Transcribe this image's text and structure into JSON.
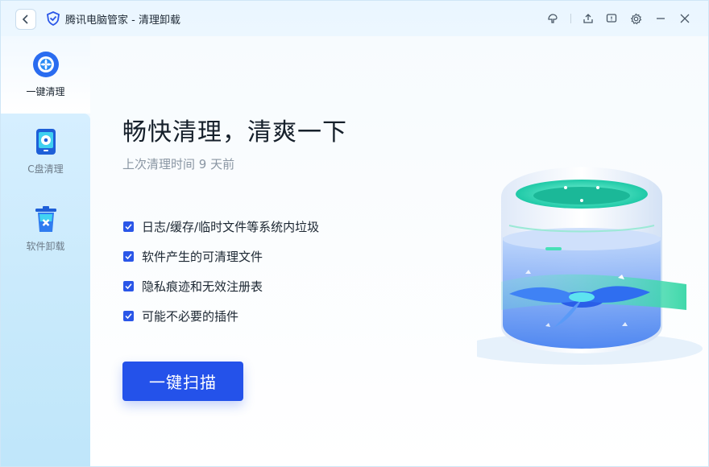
{
  "window": {
    "title": "腾讯电脑管家 - 清理卸载"
  },
  "titlebar_icons": [
    "back-icon",
    "skin-icon",
    "share-icon",
    "feedback-icon",
    "settings-icon",
    "minimize-icon",
    "close-icon"
  ],
  "sidebar": {
    "items": [
      {
        "label": "一键清理",
        "icon": "one-click-clean-icon",
        "active": true
      },
      {
        "label": "C盘清理",
        "icon": "c-drive-icon",
        "active": false
      },
      {
        "label": "软件卸载",
        "icon": "uninstall-trash-icon",
        "active": false
      }
    ]
  },
  "main": {
    "headline": "畅快清理，清爽一下",
    "subline": "上次清理时间 9 天前",
    "checklist": [
      {
        "label": "日志/缓存/临时文件等系统内垃圾",
        "checked": true
      },
      {
        "label": "软件产生的可清理文件",
        "checked": true
      },
      {
        "label": "隐私痕迹和无效注册表",
        "checked": true
      },
      {
        "label": "可能不必要的插件",
        "checked": true
      }
    ],
    "scan_button": "一键扫描"
  },
  "colors": {
    "accent": "#2452ea",
    "sidebar_bg": "#cfeafc",
    "checkbox": "#2a56e8"
  }
}
